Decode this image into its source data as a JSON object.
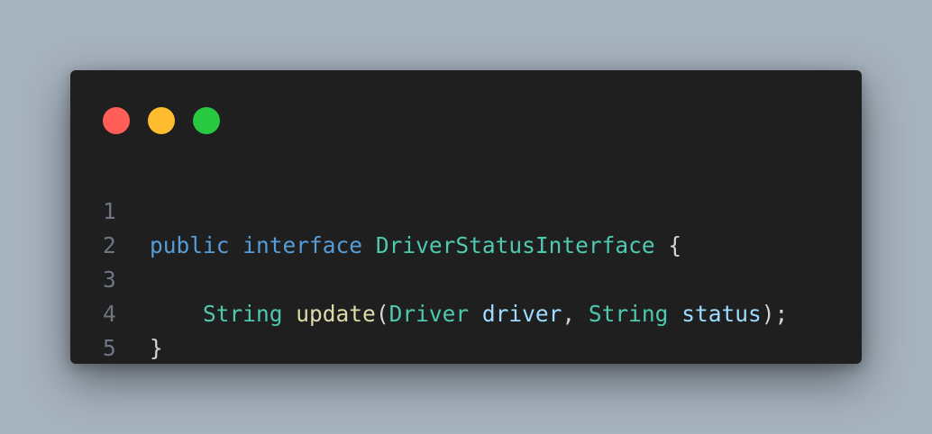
{
  "colors": {
    "background": "#a6b2be",
    "editor": "#1f1f1f",
    "dot_close": "#ff5f57",
    "dot_minimize": "#febc2e",
    "dot_maximize": "#28c840",
    "line_number": "#6e7681",
    "keyword": "#569cd6",
    "type": "#4ec9b0",
    "function": "#dcdcaa",
    "parameter": "#9cdcfe",
    "punctuation": "#d4d4d4"
  },
  "window_controls": [
    "close-dot",
    "minimize-dot",
    "maximize-dot"
  ],
  "code": {
    "line_numbers": [
      "1",
      "2",
      "3",
      "4",
      "5"
    ],
    "line1": {
      "kw_public": "public",
      "kw_interface": "interface",
      "type_name": "DriverStatusInterface",
      "brace_open": "{"
    },
    "line3": {
      "indent": "    ",
      "return_type": "String",
      "method": "update",
      "paren_open": "(",
      "param1_type": "Driver",
      "param1_name": "driver",
      "comma": ",",
      "param2_type": "String",
      "param2_name": "status",
      "paren_close": ");"
    },
    "line4": {
      "brace_close": "}"
    }
  }
}
